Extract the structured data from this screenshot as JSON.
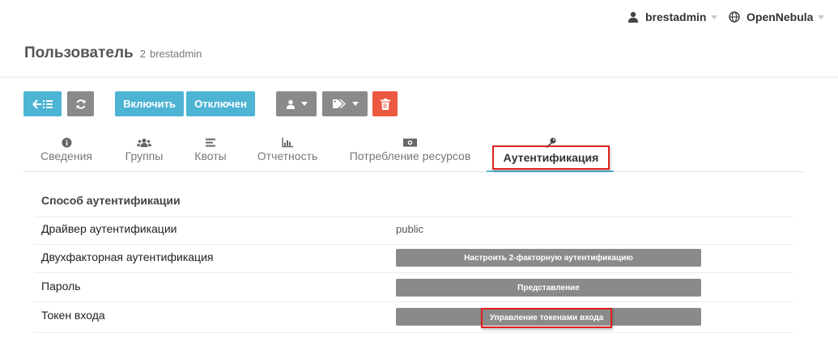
{
  "topbar": {
    "user": {
      "label": "brestadmin",
      "icon": "user-icon"
    },
    "zone": {
      "label": "OpenNebula",
      "icon": "globe-icon"
    }
  },
  "header": {
    "title": "Пользователь",
    "id": "2",
    "name": "brestadmin"
  },
  "toolbar": {
    "back_icon": "back-list-icon",
    "refresh_icon": "refresh-icon",
    "enable_label": "Включить",
    "disable_label": "Отключен",
    "user_menu_icon": "user-icon",
    "labels_menu_icon": "tags-icon",
    "delete_icon": "trash-icon"
  },
  "tabs": [
    {
      "label": "Сведения",
      "icon": "info-icon"
    },
    {
      "label": "Группы",
      "icon": "users-icon"
    },
    {
      "label": "Квоты",
      "icon": "list-icon"
    },
    {
      "label": "Отчетность",
      "icon": "bar-chart-icon"
    },
    {
      "label": "Потребление ресурсов",
      "icon": "money-icon"
    },
    {
      "label": "Аутентификация",
      "icon": "key-icon",
      "active": true
    }
  ],
  "auth": {
    "section_title": "Способ аутентификации",
    "rows": [
      {
        "label": "Драйвер аутентификации",
        "value": "public"
      },
      {
        "label": "Двухфакторная аутентификация",
        "button": "Настроить 2-факторную аутентификацию"
      },
      {
        "label": "Пароль",
        "button": "Представление"
      },
      {
        "label": "Токен входа",
        "button": "Управление токенами входа"
      }
    ]
  },
  "colors": {
    "accent": "#4eb4d4",
    "button_gray": "#8a8a8a",
    "danger": "#ec5840",
    "highlight": "#e0201e"
  }
}
